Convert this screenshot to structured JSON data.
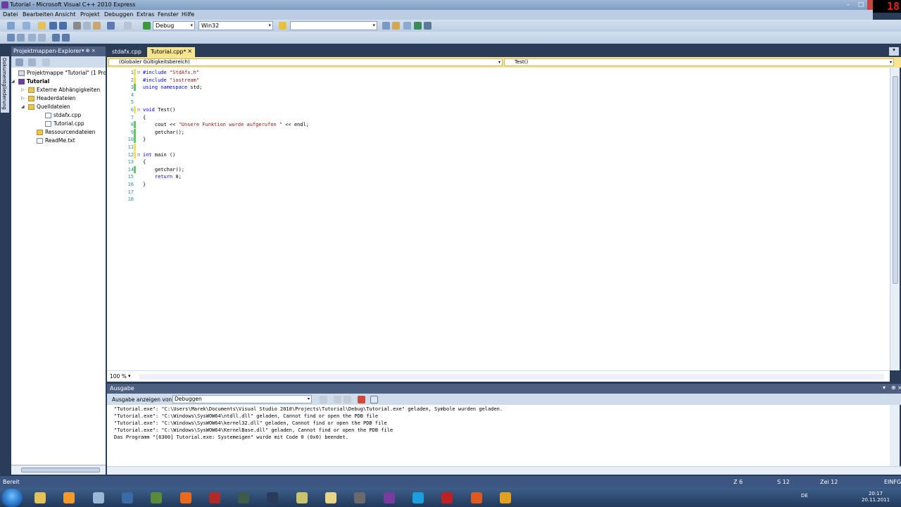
{
  "window": {
    "title": "Tutorial - Microsoft Visual C++ 2010 Express",
    "recording_badge": "18",
    "controls": {
      "minimize": "–",
      "maximize": "□",
      "close": ""
    }
  },
  "menu": [
    "Datei",
    "Bearbeiten",
    "Ansicht",
    "Projekt",
    "Debuggen",
    "Extras",
    "Fenster",
    "Hilfe"
  ],
  "toolbar": {
    "config_value": "Debug",
    "platform_value": "Win32",
    "find_value": ""
  },
  "left_strip": {
    "label": "Dokumentgliederung"
  },
  "solution_explorer": {
    "title": "Projektmappen-Explorer",
    "pin": "▾ ⊕ ×",
    "items": [
      {
        "label": "Projektmappe \"Tutorial\" (1 Projekt)",
        "icon": "solution-icon",
        "expander": ""
      },
      {
        "label": "Tutorial",
        "icon": "project-icon",
        "expander": "◢"
      },
      {
        "label": "Externe Abhängigkeiten",
        "icon": "folder-icon",
        "expander": "▷"
      },
      {
        "label": "Headerdateien",
        "icon": "folder-icon",
        "expander": "▷"
      },
      {
        "label": "Quelldateien",
        "icon": "folder-icon",
        "expander": "◢"
      },
      {
        "label": "stdafx.cpp",
        "icon": "cpp-file-icon",
        "expander": ""
      },
      {
        "label": "Tutorial.cpp",
        "icon": "cpp-file-icon",
        "expander": ""
      },
      {
        "label": "Ressourcendateien",
        "icon": "folder-icon",
        "expander": ""
      },
      {
        "label": "ReadMe.txt",
        "icon": "text-file-icon",
        "expander": ""
      }
    ]
  },
  "editor": {
    "tabs": [
      {
        "label": "stdafx.cpp",
        "active": false
      },
      {
        "label": "Tutorial.cpp*",
        "active": true,
        "close": "×"
      }
    ],
    "scope_combo": "(Globaler Gültigkeitsbereich)",
    "member_combo": "Test()",
    "lines": [
      {
        "n": "1",
        "outline": "⊟",
        "parts": [
          [
            "pp",
            "#include "
          ],
          [
            "str",
            "\"StdAfx.h\""
          ]
        ]
      },
      {
        "n": "2",
        "outline": "",
        "parts": [
          [
            "pp",
            "#include "
          ],
          [
            "str",
            "\"iostream\""
          ]
        ]
      },
      {
        "n": "3",
        "outline": "",
        "parts": [
          [
            "kw",
            "using namespace"
          ],
          [
            "",
            " std;"
          ]
        ]
      },
      {
        "n": "4",
        "outline": "",
        "parts": []
      },
      {
        "n": "5",
        "outline": "",
        "parts": []
      },
      {
        "n": "6",
        "outline": "⊟",
        "parts": [
          [
            "kw",
            "void"
          ],
          [
            "",
            " Test()"
          ]
        ]
      },
      {
        "n": "7",
        "outline": "",
        "parts": [
          [
            "",
            "{"
          ]
        ]
      },
      {
        "n": "8",
        "outline": "",
        "parts": [
          [
            "",
            "    cout << "
          ],
          [
            "str",
            "\"Unsere Funktion wurde aufgerufen \""
          ],
          [
            "",
            " << endl;"
          ]
        ]
      },
      {
        "n": "9",
        "outline": "",
        "parts": [
          [
            "",
            "    getchar();"
          ]
        ]
      },
      {
        "n": "10",
        "outline": "",
        "parts": [
          [
            "",
            "}"
          ]
        ]
      },
      {
        "n": "11",
        "outline": "",
        "parts": []
      },
      {
        "n": "12",
        "outline": "⊟",
        "parts": [
          [
            "kw",
            "int"
          ],
          [
            "",
            " main ()"
          ]
        ]
      },
      {
        "n": "13",
        "outline": "",
        "parts": [
          [
            "",
            "{"
          ]
        ]
      },
      {
        "n": "14",
        "outline": "",
        "parts": [
          [
            "",
            "    getchar();"
          ]
        ]
      },
      {
        "n": "15",
        "outline": "",
        "parts": [
          [
            "",
            "    "
          ],
          [
            "kw",
            "return"
          ],
          [
            "",
            " 0;"
          ]
        ]
      },
      {
        "n": "16",
        "outline": "",
        "parts": [
          [
            "",
            "}"
          ]
        ]
      },
      {
        "n": "17",
        "outline": "",
        "parts": []
      },
      {
        "n": "18",
        "outline": "",
        "parts": []
      }
    ],
    "zoom": "100 %"
  },
  "output": {
    "title": "Ausgabe",
    "show_from_label": "Ausgabe anzeigen von:",
    "source_value": "Debuggen",
    "lines": [
      "\"Tutorial.exe\": \"C:\\Users\\Marek\\Documents\\Visual Studio 2010\\Projects\\Tutorial\\Debug\\Tutorial.exe\" geladen, Symbole wurden geladen.",
      "\"Tutorial.exe\": \"C:\\Windows\\SysWOW64\\ntdll.dll\" geladen, Cannot find or open the PDB file",
      "\"Tutorial.exe\": \"C:\\Windows\\SysWOW64\\kernel32.dll\" geladen, Cannot find or open the PDB file",
      "\"Tutorial.exe\": \"C:\\Windows\\SysWOW64\\KernelBase.dll\" geladen, Cannot find or open the PDB file",
      "Das Programm \"[6300] Tutorial.exe: Systemeigen\" wurde mit Code 0 (0x0) beendet."
    ]
  },
  "status": {
    "left": "Bereit",
    "line": "Z 6",
    "col": "S 12",
    "char": "Zei 12",
    "mode": "EINFG"
  },
  "taskbar": {
    "apps": [
      {
        "name": "explorer",
        "color": "#e3c25a"
      },
      {
        "name": "media-player",
        "color": "#f39a2a"
      },
      {
        "name": "chrome",
        "color": "#9ab7d8"
      },
      {
        "name": "tasks",
        "color": "#3a6aa8"
      },
      {
        "name": "minecraft",
        "color": "#5a8a3a"
      },
      {
        "name": "firefox",
        "color": "#e86a1a"
      },
      {
        "name": "visual-studio",
        "color": "#b02a2a"
      },
      {
        "name": "app-dark",
        "color": "#3e5a4a"
      },
      {
        "name": "steam",
        "color": "#2a3a5a"
      },
      {
        "name": "notes",
        "color": "#c9c46a"
      },
      {
        "name": "paint",
        "color": "#e8d58a"
      },
      {
        "name": "gimp",
        "color": "#6a6a6a"
      },
      {
        "name": "tor",
        "color": "#7a3aa0"
      },
      {
        "name": "skype",
        "color": "#1aa0e0"
      },
      {
        "name": "filezilla",
        "color": "#c02020"
      },
      {
        "name": "ubuntu",
        "color": "#e05a20"
      },
      {
        "name": "network",
        "color": "#e0a020"
      }
    ],
    "language": "DE",
    "time": "20:17",
    "date": "20.11.2011"
  }
}
